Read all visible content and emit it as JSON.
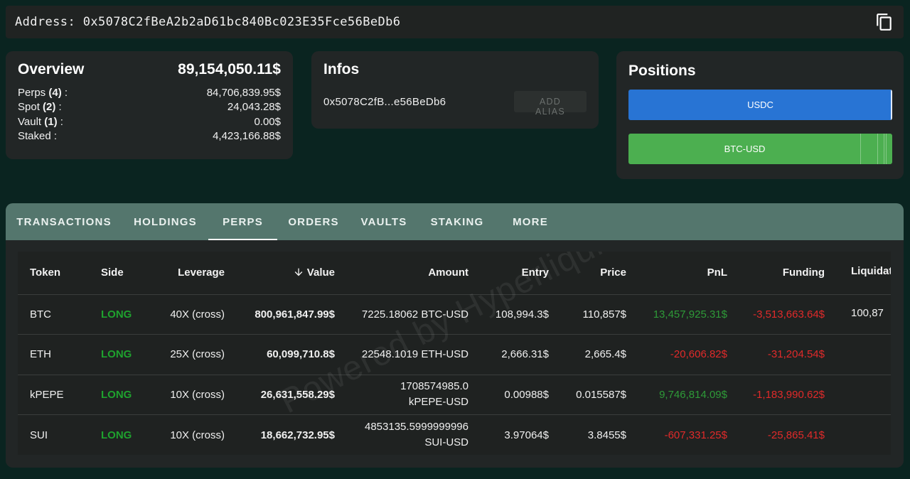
{
  "address": {
    "label": "Address: 0x5078C2fBeA2b2aD61bc840Bc023E35Fce56BeDb6"
  },
  "overview": {
    "title": "Overview",
    "total": "89,154,050.11$",
    "rows": [
      {
        "name": "Perps",
        "count": "(4)",
        "suffix": " :",
        "value": "84,706,839.95$"
      },
      {
        "name": "Spot",
        "count": "(2)",
        "suffix": " :",
        "value": "24,043.28$"
      },
      {
        "name": "Vault",
        "count": "(1)",
        "suffix": " :",
        "value": "0.00$"
      },
      {
        "name": "Staked :",
        "count": "",
        "suffix": "",
        "value": "4,423,166.88$"
      }
    ]
  },
  "infos": {
    "title": "Infos",
    "short_address": "0x5078C2fB...e56BeDb6",
    "alias_button": "ADD ALIAS"
  },
  "positions": {
    "title": "Positions",
    "bars": [
      {
        "label": "USDC",
        "color": "#2874d4"
      },
      {
        "label": "BTC-USD",
        "color": "#4caf50"
      }
    ]
  },
  "tabs": [
    {
      "label": "TRANSACTIONS",
      "active": false
    },
    {
      "label": "HOLDINGS",
      "active": false
    },
    {
      "label": "PERPS",
      "active": true
    },
    {
      "label": "ORDERS",
      "active": false
    },
    {
      "label": "VAULTS",
      "active": false
    },
    {
      "label": "STAKING",
      "active": false
    },
    {
      "label": "MORE",
      "active": false
    }
  ],
  "table": {
    "headers": [
      "Token",
      "Side",
      "Leverage",
      "Value",
      "Amount",
      "Entry",
      "Price",
      "PnL",
      "Funding",
      "Liquidati"
    ],
    "rows": [
      {
        "token": "BTC",
        "side": "LONG",
        "leverage": "40X (cross)",
        "value": "800,961,847.99$",
        "amount": "7225.18062 BTC-USD",
        "amount2": "",
        "entry": "108,994.3$",
        "price": "110,857$",
        "pnl": "13,457,925.31$",
        "pnl_sign": "pos",
        "funding": "-3,513,663.64$",
        "liquidation": "100,87"
      },
      {
        "token": "ETH",
        "side": "LONG",
        "leverage": "25X (cross)",
        "value": "60,099,710.8$",
        "amount": "22548.1019 ETH-USD",
        "amount2": "",
        "entry": "2,666.31$",
        "price": "2,665.4$",
        "pnl": "-20,606.82$",
        "pnl_sign": "neg",
        "funding": "-31,204.54$",
        "liquidation": ""
      },
      {
        "token": "kPEPE",
        "side": "LONG",
        "leverage": "10X (cross)",
        "value": "26,631,558.29$",
        "amount": "1708574985.0",
        "amount2": "kPEPE-USD",
        "entry": "0.00988$",
        "price": "0.015587$",
        "pnl": "9,746,814.09$",
        "pnl_sign": "pos",
        "funding": "-1,183,990.62$",
        "liquidation": ""
      },
      {
        "token": "SUI",
        "side": "LONG",
        "leverage": "10X (cross)",
        "value": "18,662,732.95$",
        "amount": "4853135.5999999996",
        "amount2": "SUI-USD",
        "entry": "3.97064$",
        "price": "3.8455$",
        "pnl": "-607,331.25$",
        "pnl_sign": "neg",
        "funding": "-25,865.41$",
        "liquidation": ""
      }
    ]
  },
  "watermark": "Powered by Hyperliquid",
  "icons": {
    "copy": "copy-icon",
    "sort": "arrow-down-icon"
  }
}
